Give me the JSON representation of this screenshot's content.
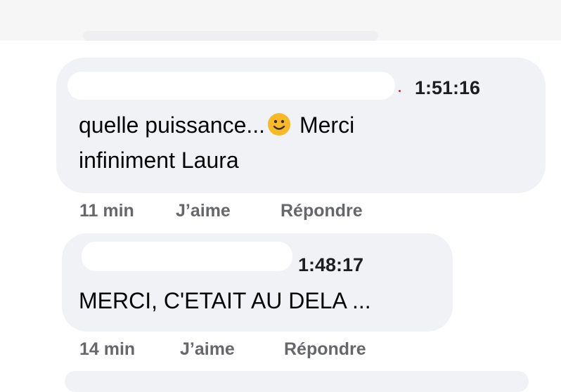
{
  "comments": [
    {
      "timestamp": "1:51:16",
      "message_line1": "quelle puissance...",
      "emoji": "slightly-smiling-face",
      "message_line1_end": "Merci",
      "message_line2": "infiniment Laura",
      "age": "11 min",
      "like_label": "J’aime",
      "reply_label": "Répondre"
    },
    {
      "timestamp": "1:48:17",
      "message_line1": "MERCI, C'ETAIT AU DELA ...",
      "age": "14 min",
      "like_label": "J’aime",
      "reply_label": "Répondre"
    }
  ],
  "colors": {
    "bubble": "#f0f2f5",
    "text": "#050505",
    "meta": "#65676b",
    "emoji_face": "#f7b928"
  }
}
